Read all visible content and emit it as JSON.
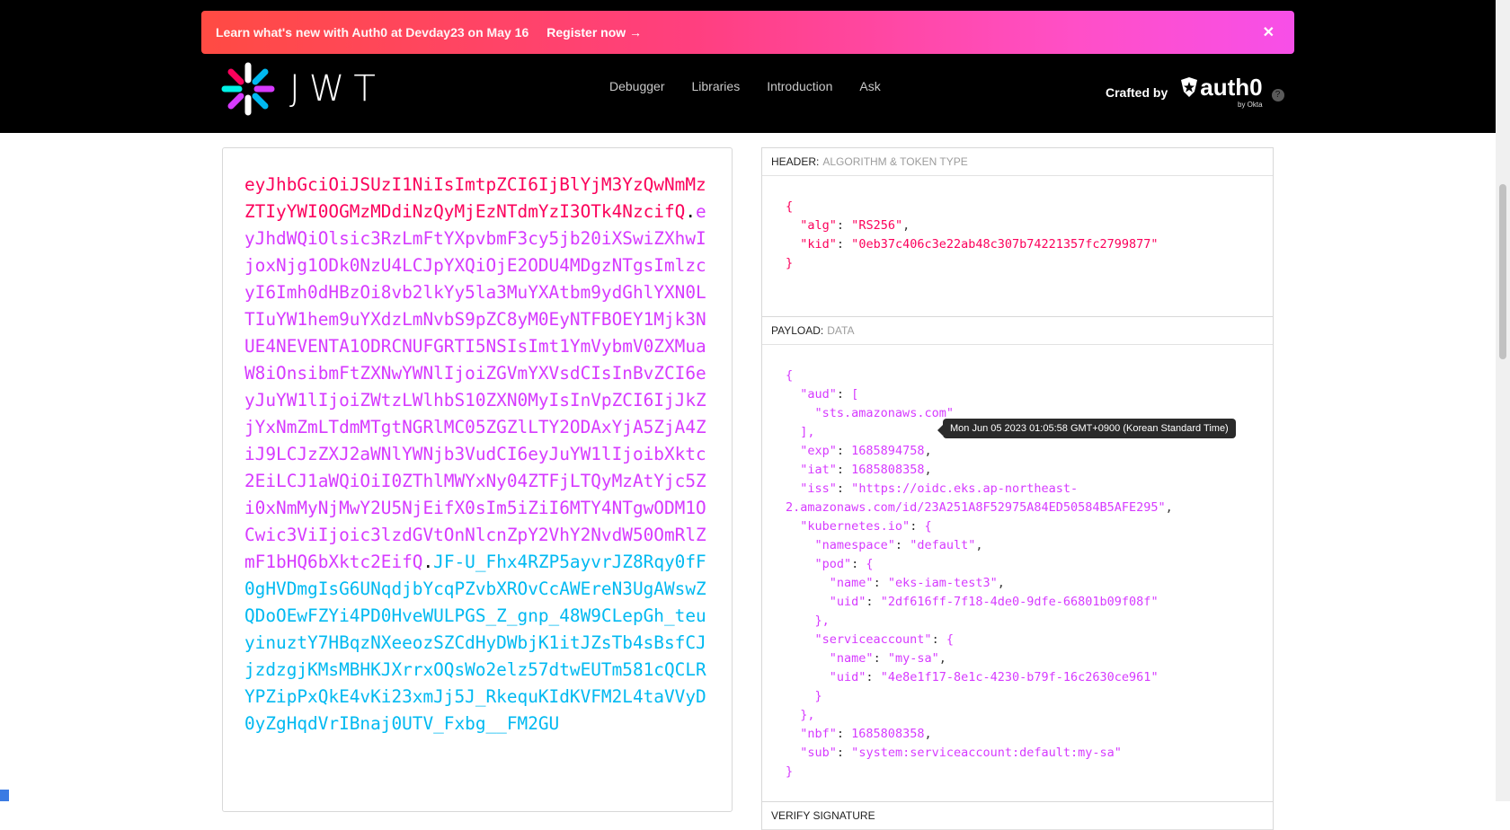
{
  "banner": {
    "message": "Learn what's new with Auth0 at Devday23 on May 16",
    "cta": "Register now →",
    "close": "✕"
  },
  "logo": {
    "word": "JWT"
  },
  "nav": [
    "Debugger",
    "Libraries",
    "Introduction",
    "Ask"
  ],
  "crafted": {
    "label": "Crafted by",
    "brand": "auth0",
    "sub": "by Okta",
    "help": "?"
  },
  "encoded": {
    "header": "eyJhbGciOiJSUzI1NiIsImtpZCI6IjBlYjM3YzQwNmMzZTIyYWI0OGMzMDdiNzQyMjEzNTdmYzI3OTk4NzcifQ",
    "payload": "eyJhdWQiOlsic3RzLmFtYXpvbmF3cy5jb20iXSwiZXhwIjoxNjg1ODk0NzU4LCJpYXQiOjE2ODU4MDgzNTgsImlzcyI6Imh0dHBzOi8vb2lkYy5la3MuYXAtbm9ydGhlYXN0LTIuYW1hem9uYXdzLmNvbS9pZC8yM0EyNTFBOEY1Mjk3NUE4NEVENTA1ODRCNUFGRTI5NSIsImt1YmVybmV0ZXMuaW8iOnsibmFtZXNwYWNlIjoiZGVmYXVsdCIsInBvZCI6eyJuYW1lIjoiZWtzLWlhbS10ZXN0MyIsInVpZCI6IjJkZjYxNmZmLTdmMTgtNGRlMC05ZGZlLTY2ODAxYjA5ZjA4ZiJ9LCJzZXJ2aWNlYWNjb3VudCI6eyJuYW1lIjoibXktc2EiLCJ1aWQiOiI0ZThlMWYxNy04ZTFjLTQyMzAtYjc5Zi0xNmMyNjMwY2U5NjEifX0sIm5iZiI6MTY4NTgwODM1OCwic3ViIjoic3lzdGVtOnNlcnZpY2VhY2NvdW50OmRlZmF1bHQ6bXktc2EifQ",
    "signature": "JF-U_Fhx4RZP5ayvrJZ8Rqy0fF0gHVDmgIsG6UNqdjbYcqPZvbXROvCcAWEreN3UgAWswZQDoOEwFZYi4PD0HveWULPGS_Z_gnp_48W9CLepGh_teuyinuztY7HBqzNXeeozSZCdHyDWbjK1itJZsTb4sBsfCJjzdzgjKMsMBHKJXrrxOQsWo2elz57dtwEUTm581cQCLRYPZipPxQkE4vKi23xmJj5J_RkequKIdKVFM2L4taVVyD0yZgHqdVrIBnaj0UTV_Fxbg__FM2GU"
  },
  "header_section": {
    "title": "HEADER:",
    "subtitle": "ALGORITHM & TOKEN TYPE",
    "alg": "RS256",
    "kid": "0eb37c406c3e22ab48c307b74221357fc2799877"
  },
  "payload_section": {
    "title": "PAYLOAD:",
    "subtitle": "DATA",
    "aud0": "sts.amazonaws.com",
    "exp": "1685894758",
    "iat": "1685808358",
    "iss_1": "https://oidc.eks.ap-northeast-",
    "iss_2": "2.amazonaws.com/id/23A251A8F52975A84ED50584B5AFE295",
    "namespace": "default",
    "pod_name": "eks-iam-test3",
    "pod_uid": "2df616ff-7f18-4de0-9dfe-66801b09f08f",
    "sa_name": "my-sa",
    "sa_uid": "4e8e1f17-8e1c-4230-b79f-16c2630ce961",
    "nbf": "1685808358",
    "sub": "system:serviceaccount:default:my-sa"
  },
  "tooltip": "Mon Jun 05 2023 01:05:58 GMT+0900 (Korean Standard Time)",
  "verify_section": {
    "title": "VERIFY SIGNATURE"
  },
  "colors": {
    "header": "#fb015b",
    "payload": "#d63aff",
    "signature": "#00b9f1"
  }
}
